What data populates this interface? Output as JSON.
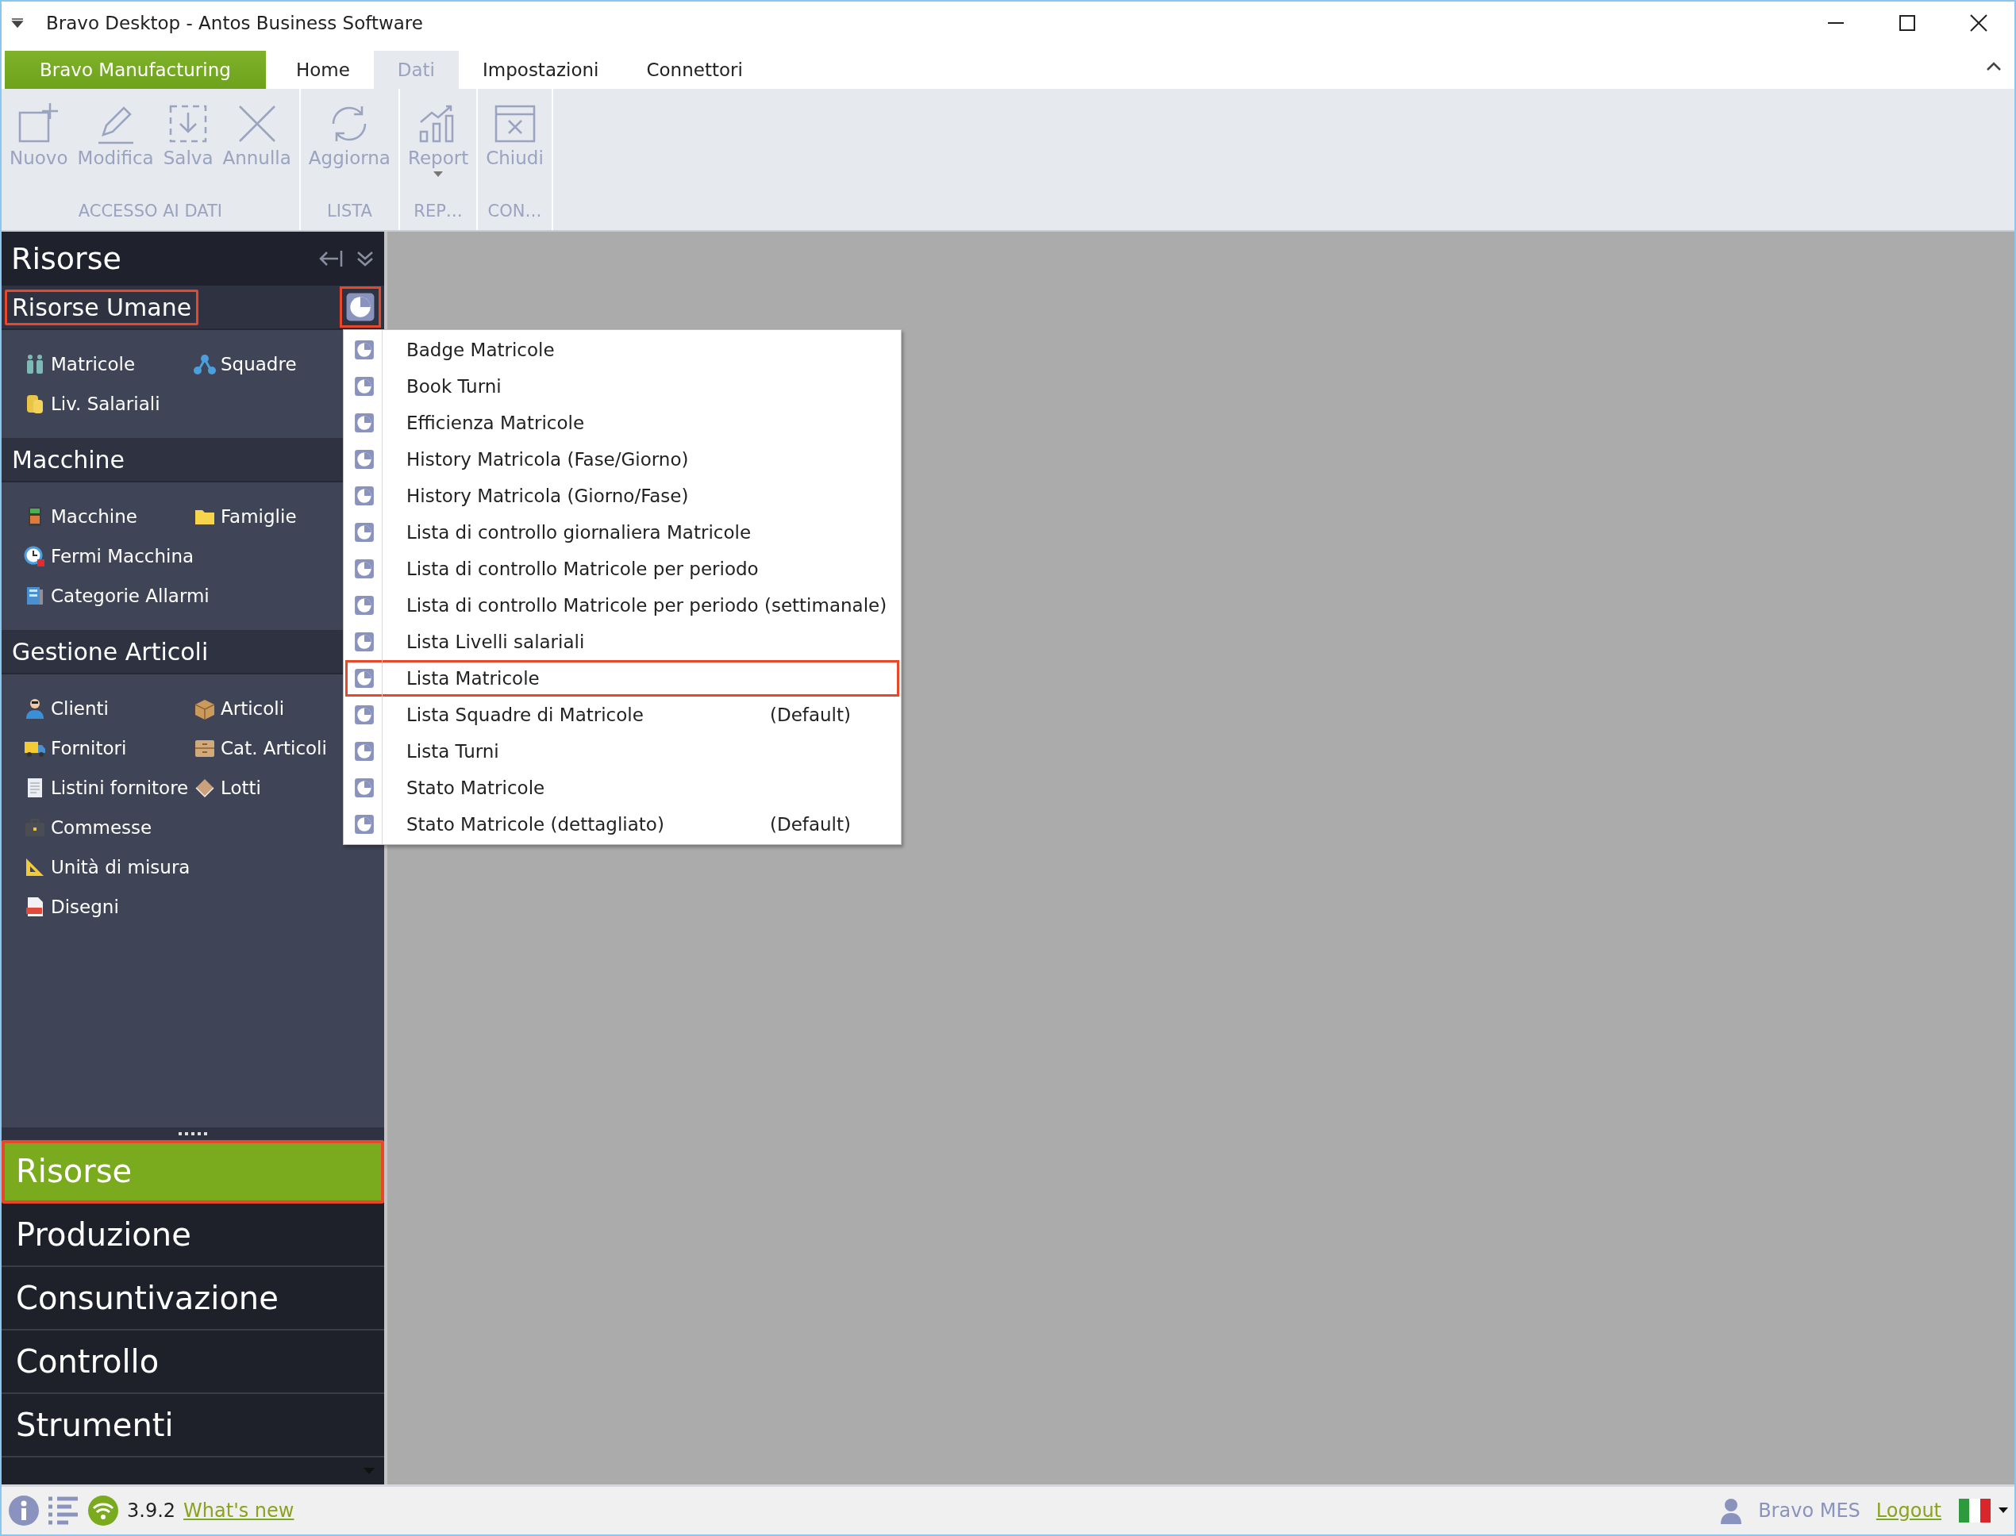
{
  "window": {
    "title": "Bravo Desktop - Antos Business Software"
  },
  "ribbon_tabs": [
    {
      "label": "Bravo Manufacturing",
      "kind": "app",
      "selected": false
    },
    {
      "label": "Home",
      "kind": "tab",
      "selected": false
    },
    {
      "label": "Dati",
      "kind": "tab",
      "selected": true
    },
    {
      "label": "Impostazioni",
      "kind": "tab",
      "selected": false
    },
    {
      "label": "Connettori",
      "kind": "tab",
      "selected": false
    }
  ],
  "ribbon_groups": [
    {
      "label": "ACCESSO AI DATI",
      "buttons": [
        {
          "label": "Nuovo",
          "kind": "new",
          "disabled": true,
          "dropdown": false
        },
        {
          "label": "Modifica",
          "kind": "edit",
          "disabled": true,
          "dropdown": false
        },
        {
          "label": "Salva",
          "kind": "save",
          "disabled": true,
          "dropdown": false
        },
        {
          "label": "Annulla",
          "kind": "cancel",
          "disabled": true,
          "dropdown": false
        }
      ]
    },
    {
      "label": "LISTA",
      "buttons": [
        {
          "label": "Aggiorna",
          "kind": "refresh",
          "disabled": true,
          "dropdown": false
        }
      ]
    },
    {
      "label": "REP…",
      "buttons": [
        {
          "label": "Report",
          "kind": "report",
          "disabled": true,
          "dropdown": true
        }
      ]
    },
    {
      "label": "CON…",
      "buttons": [
        {
          "label": "Chiudi",
          "kind": "close",
          "disabled": true,
          "dropdown": false
        }
      ]
    }
  ],
  "sidebar": {
    "title": "Risorse",
    "sections": [
      {
        "title": "Risorse Umane",
        "highlighted": true,
        "report_button": {
          "highlighted": true
        },
        "rows": [
          [
            {
              "label": "Matricole",
              "kind": "people"
            },
            {
              "label": "Squadre",
              "kind": "network"
            }
          ],
          [
            {
              "label": "Liv. Salariali",
              "kind": "coins"
            }
          ]
        ]
      },
      {
        "title": "Macchine",
        "highlighted": false,
        "rows": [
          [
            {
              "label": "Macchine",
              "kind": "calculator"
            },
            {
              "label": "Famiglie",
              "kind": "folder"
            }
          ],
          [
            {
              "label": "Fermi Macchina",
              "kind": "clock"
            }
          ],
          [
            {
              "label": "Categorie Allarmi",
              "kind": "cabinet"
            }
          ]
        ]
      },
      {
        "title": "Gestione Articoli",
        "highlighted": false,
        "rows": [
          [
            {
              "label": "Clienti",
              "kind": "person"
            },
            {
              "label": "Articoli",
              "kind": "box"
            }
          ],
          [
            {
              "label": "Fornitori",
              "kind": "truck"
            },
            {
              "label": "Cat. Articoli",
              "kind": "drawer"
            }
          ],
          [
            {
              "label": "Listini fornitore",
              "kind": "receipt"
            },
            {
              "label": "Lotti",
              "kind": "diamond"
            }
          ],
          [
            {
              "label": "Commesse",
              "kind": "briefcase"
            }
          ],
          [
            {
              "label": "Unità di misura",
              "kind": "set-square"
            }
          ],
          [
            {
              "label": "Disegni",
              "kind": "file"
            }
          ]
        ]
      }
    ]
  },
  "report_menu": [
    {
      "label": "Badge Matricole",
      "highlighted": false
    },
    {
      "label": "Book Turni",
      "highlighted": false
    },
    {
      "label": "Efficienza Matricole",
      "highlighted": false
    },
    {
      "label": "History Matricola (Fase/Giorno)",
      "highlighted": false
    },
    {
      "label": "History Matricola (Giorno/Fase)",
      "highlighted": false
    },
    {
      "label": "Lista di controllo giornaliera Matricole",
      "highlighted": false
    },
    {
      "label": "Lista di controllo Matricole per periodo",
      "highlighted": false
    },
    {
      "label": "Lista di controllo Matricole per periodo (settimanale)",
      "highlighted": false
    },
    {
      "label": "Lista Livelli salariali",
      "highlighted": false
    },
    {
      "label": "Lista Matricole",
      "highlighted": true
    },
    {
      "label": "Lista Squadre di Matricole",
      "tag": "(Default)",
      "highlighted": false
    },
    {
      "label": "Lista Turni",
      "highlighted": false
    },
    {
      "label": "Stato Matricole",
      "highlighted": false
    },
    {
      "label": "Stato Matricole (dettagliato)",
      "tag": "(Default)",
      "highlighted": false
    }
  ],
  "nav": [
    {
      "label": "Risorse",
      "selected": true,
      "highlighted": true
    },
    {
      "label": "Produzione",
      "selected": false,
      "highlighted": false
    },
    {
      "label": "Consuntivazione",
      "selected": false,
      "highlighted": false
    },
    {
      "label": "Controllo",
      "selected": false,
      "highlighted": false
    },
    {
      "label": "Strumenti",
      "selected": false,
      "highlighted": false
    }
  ],
  "status_bar": {
    "version": "3.9.2",
    "whats_new": "What's new",
    "user": "Bravo MES",
    "logout": "Logout"
  }
}
